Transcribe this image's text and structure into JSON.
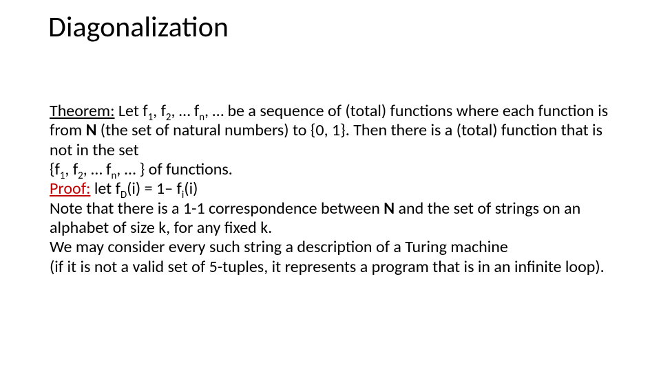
{
  "title": "Diagonalization",
  "theoremLabel": "Theorem:",
  "t1a": " Let f",
  "t1b": ", f",
  "t1c": ", … f",
  "t1d": ", … be a sequence of (total) functions where each function is from ",
  "Nbold": "N",
  "t1e": " (the set of natural numbers) to {0, 1}. Then there is a (total) function that is not in the set",
  "set_a": "{f",
  "set_b": ", f",
  "set_c": ", … f",
  "set_d": ", … } of functions.",
  "proofLabel": "Proof:",
  "p1a": " let f",
  "p1b": "(i) = 1– f",
  "p1c": "(i)",
  "note_a": "Note that there is a 1-1 correspondence between ",
  "note_b": " and the set of strings on an alphabet of size k, for any fixed k.",
  "consider": "We may consider every such string a description of a Turing machine",
  "paren": "(if it is not a valid set of 5-tuples, it represents a program that is in an infinite loop).",
  "sub1": "1",
  "sub2": "2",
  "subn": "n",
  "subD": "D",
  "subi": "i"
}
